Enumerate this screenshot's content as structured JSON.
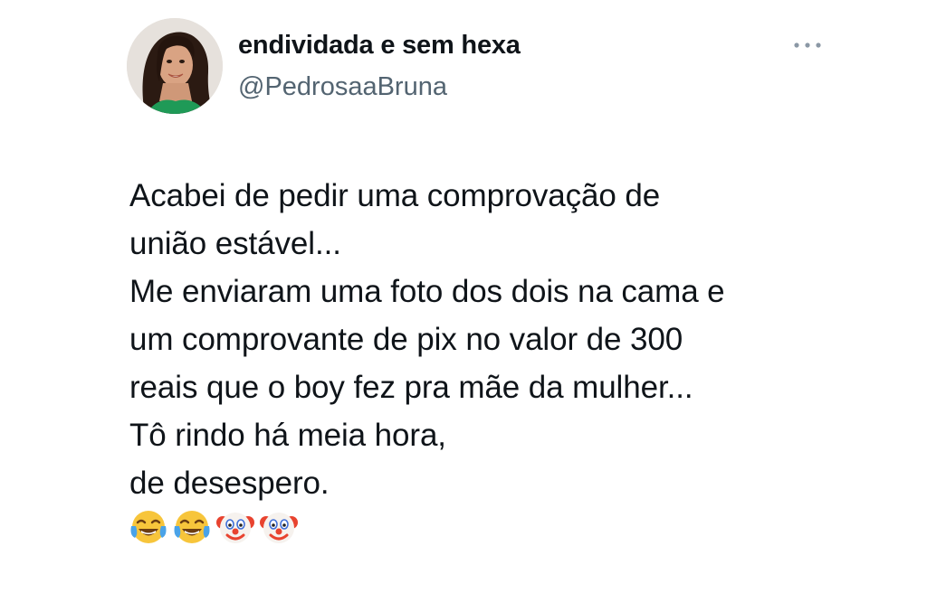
{
  "user": {
    "display_name": "endividada e sem hexa",
    "handle": "@PedrosaaBruna"
  },
  "menu": {
    "icon": "more-horizontal-icon"
  },
  "tweet": {
    "lines": [
      "Acabei de pedir uma comprovação de",
      "união estável...",
      "Me enviaram uma foto dos dois na cama e",
      "um comprovante de pix no valor de 300",
      "reais que o boy fez pra mãe da mulher...",
      "Tô rindo há meia hora,",
      "de desespero."
    ],
    "emojis": [
      "tears-of-joy-emoji-icon",
      "tears-of-joy-emoji-icon",
      "clown-face-emoji-icon",
      "clown-face-emoji-icon"
    ]
  },
  "colors": {
    "text": "#0f1419",
    "secondary_text": "#536471",
    "background": "#ffffff"
  }
}
